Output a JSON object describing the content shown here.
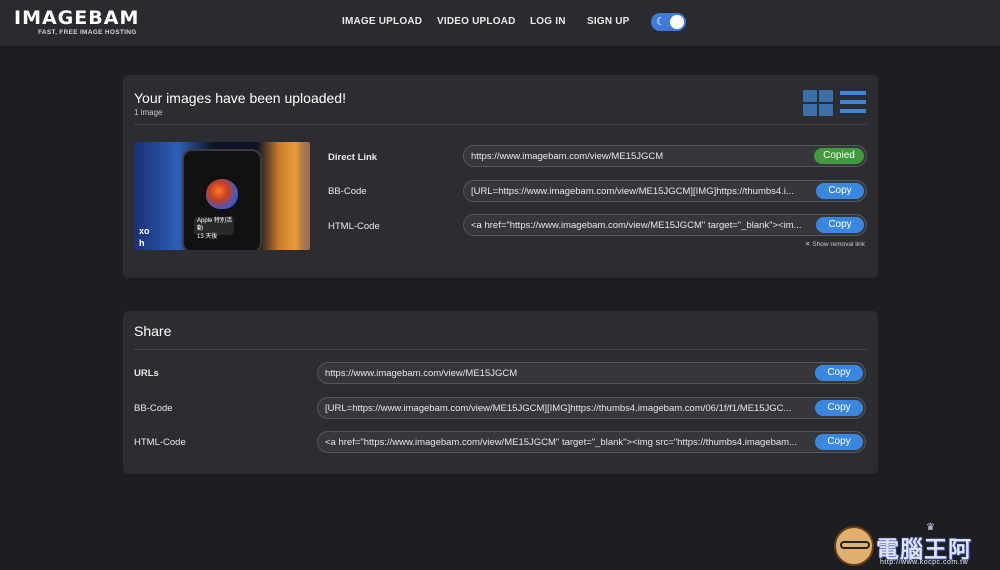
{
  "header": {
    "logo_title": "IMAGEBAM",
    "logo_tagline": "FAST, FREE IMAGE HOSTING",
    "nav": {
      "image_upload": "IMAGE UPLOAD",
      "video_upload": "VIDEO UPLOAD",
      "login": "LOG IN",
      "signup": "SIGN UP"
    },
    "theme_toggle_icon": "moon-icon",
    "theme_toggle_on": true
  },
  "upload_panel": {
    "title": "Your images have been uploaded!",
    "count": "1 image",
    "view_buttons": [
      "grid-view-icon",
      "list-view-icon"
    ],
    "thumbnail_texts": {
      "card_top": "Apple 特別活動",
      "card_main": "13 天後",
      "left_1": "xo",
      "left_2": "h"
    },
    "rows": [
      {
        "label": "Direct Link",
        "value": "https://www.imagebam.com/view/ME15JGCM",
        "button": "Copied"
      },
      {
        "label": "BB-Code",
        "value": "[URL=https://www.imagebam.com/view/ME15JGCM][IMG]https://thumbs4.i...",
        "button": "Copy"
      },
      {
        "label": "HTML-Code",
        "value": "<a href=\"https://www.imagebam.com/view/ME15JGCM\" target=\"_blank\"><im...",
        "button": "Copy"
      }
    ],
    "show_removal_link": "Show removal link"
  },
  "share_panel": {
    "title": "Share",
    "rows": [
      {
        "label": "URLs",
        "value": "https://www.imagebam.com/view/ME15JGCM",
        "button": "Copy"
      },
      {
        "label": "BB-Code",
        "value": "[URL=https://www.imagebam.com/view/ME15JGCM][IMG]https://thumbs4.imagebam.com/06/1f/f1/ME15JGC...",
        "button": "Copy"
      },
      {
        "label": "HTML-Code",
        "value": "<a href=\"https://www.imagebam.com/view/ME15JGCM\" target=\"_blank\"><img src=\"https://thumbs4.imagebam...",
        "button": "Copy"
      }
    ]
  },
  "watermark": {
    "title": "電腦王阿達",
    "url": "http://www.kocpc.com.tw"
  },
  "colors": {
    "background": "#1d1e21",
    "panel": "#2c2d31",
    "accent": "#3a87e0",
    "success": "#3f9b3c"
  }
}
